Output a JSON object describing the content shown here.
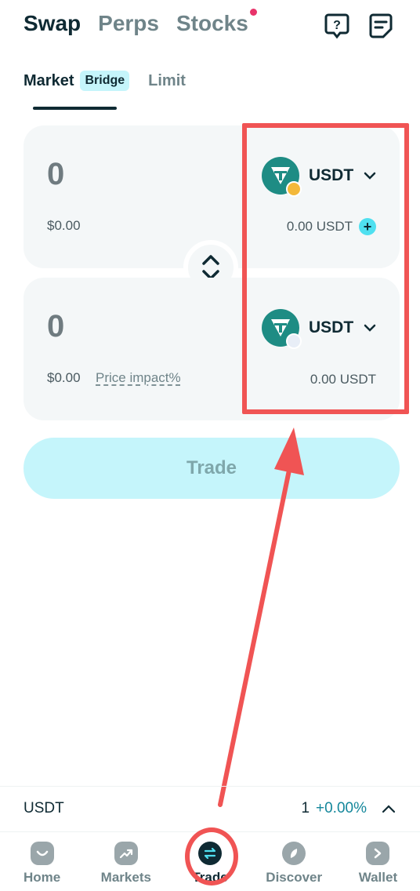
{
  "top_tabs": {
    "swap": "Swap",
    "perps": "Perps",
    "stocks": "Stocks"
  },
  "icons": {
    "help": "help-icon",
    "notes": "notes-icon"
  },
  "sub_tabs": {
    "market": "Market",
    "bridge_badge": "Bridge",
    "limit": "Limit"
  },
  "from": {
    "amount": "0",
    "fiat": "$0.00",
    "token": "USDT",
    "balance": "0.00 USDT",
    "plus": "+"
  },
  "to": {
    "amount": "0",
    "fiat": "$0.00",
    "price_impact": "Price impact%",
    "token": "USDT",
    "balance": "0.00 USDT"
  },
  "trade_button": "Trade",
  "ticker": {
    "symbol": "USDT",
    "value": "1",
    "change": "+0.00%"
  },
  "nav": [
    {
      "label": "Home",
      "icon": "home-icon"
    },
    {
      "label": "Markets",
      "icon": "markets-icon"
    },
    {
      "label": "Trade",
      "icon": "trade-icon"
    },
    {
      "label": "Discover",
      "icon": "discover-icon"
    },
    {
      "label": "Wallet",
      "icon": "wallet-icon"
    }
  ],
  "colors": {
    "accent": "#4fe0f0",
    "annotation": "#f05454",
    "primary_text": "#0f2a33",
    "notification_dot": "#e8336a"
  }
}
